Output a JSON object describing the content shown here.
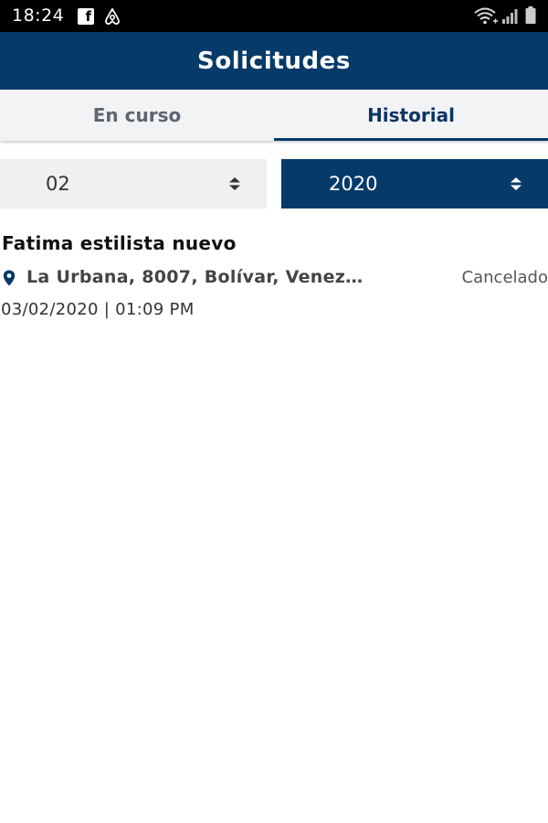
{
  "status_bar": {
    "time": "18:24",
    "fb_glyph": "f",
    "icons": [
      "facebook-icon",
      "airbnb-icon",
      "wifi-icon",
      "signal-icon",
      "battery-icon"
    ]
  },
  "header": {
    "title": "Solicitudes"
  },
  "tabs": [
    {
      "label": "En curso",
      "active": false
    },
    {
      "label": "Historial",
      "active": true
    }
  ],
  "filters": {
    "month": "02",
    "year": "2020"
  },
  "requests": [
    {
      "title": "Fatima estilista nuevo",
      "address": "La Urbana, 8007, Bolívar, Venez…",
      "status": "Cancelado",
      "datetime": "03/02/2020 | 01:09 PM"
    }
  ],
  "colors": {
    "primary": "#063a69",
    "tab_background": "#f2f3f5",
    "select_background": "#f0f0f0",
    "status_bar": "#000000"
  }
}
